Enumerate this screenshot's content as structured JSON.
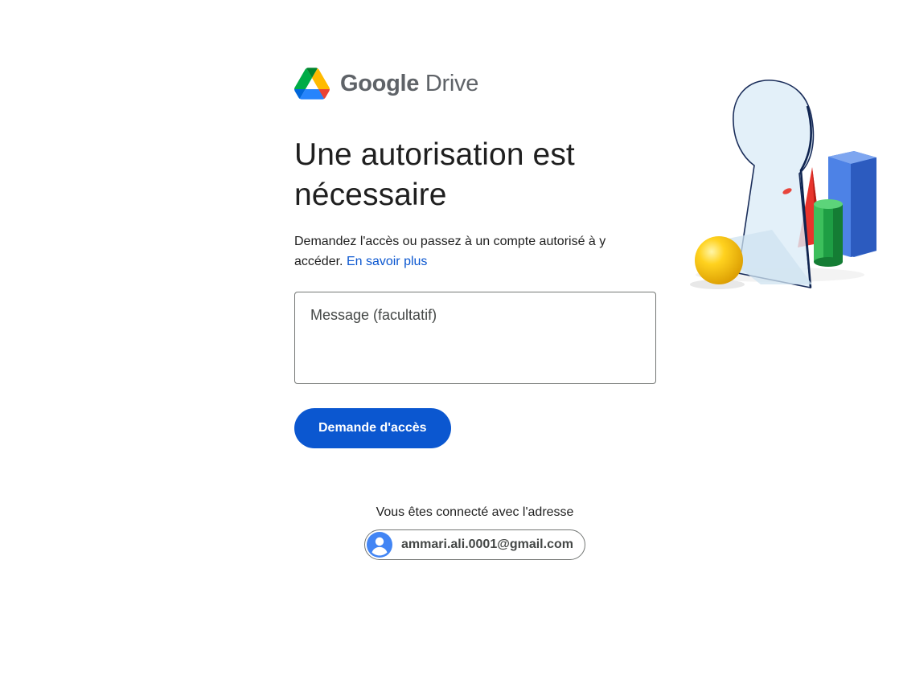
{
  "brand": {
    "google": "Google",
    "product": "Drive",
    "logo_icon": "google-drive-logo"
  },
  "main": {
    "title_line1": "Une autorisation est",
    "title_line2": "nécessaire",
    "description": "Demandez l'accès ou passez à un compte autorisé à y accéder.",
    "learn_more_link": "En savoir plus",
    "message_placeholder": "Message (facultatif)",
    "message_value": "",
    "request_button": "Demande d'accès"
  },
  "account": {
    "signed_in_label": "Vous êtes connecté avec l'adresse",
    "email": "ammari.ali.0001@gmail.com",
    "avatar_icon": "person-avatar-icon"
  },
  "illustration": {
    "icon": "keyhole-mirror-shapes-illustration"
  },
  "colors": {
    "primary": "#0b57d0",
    "link": "#0b57d0",
    "text": "#1f1f1f",
    "avatar": "#4285f4"
  }
}
